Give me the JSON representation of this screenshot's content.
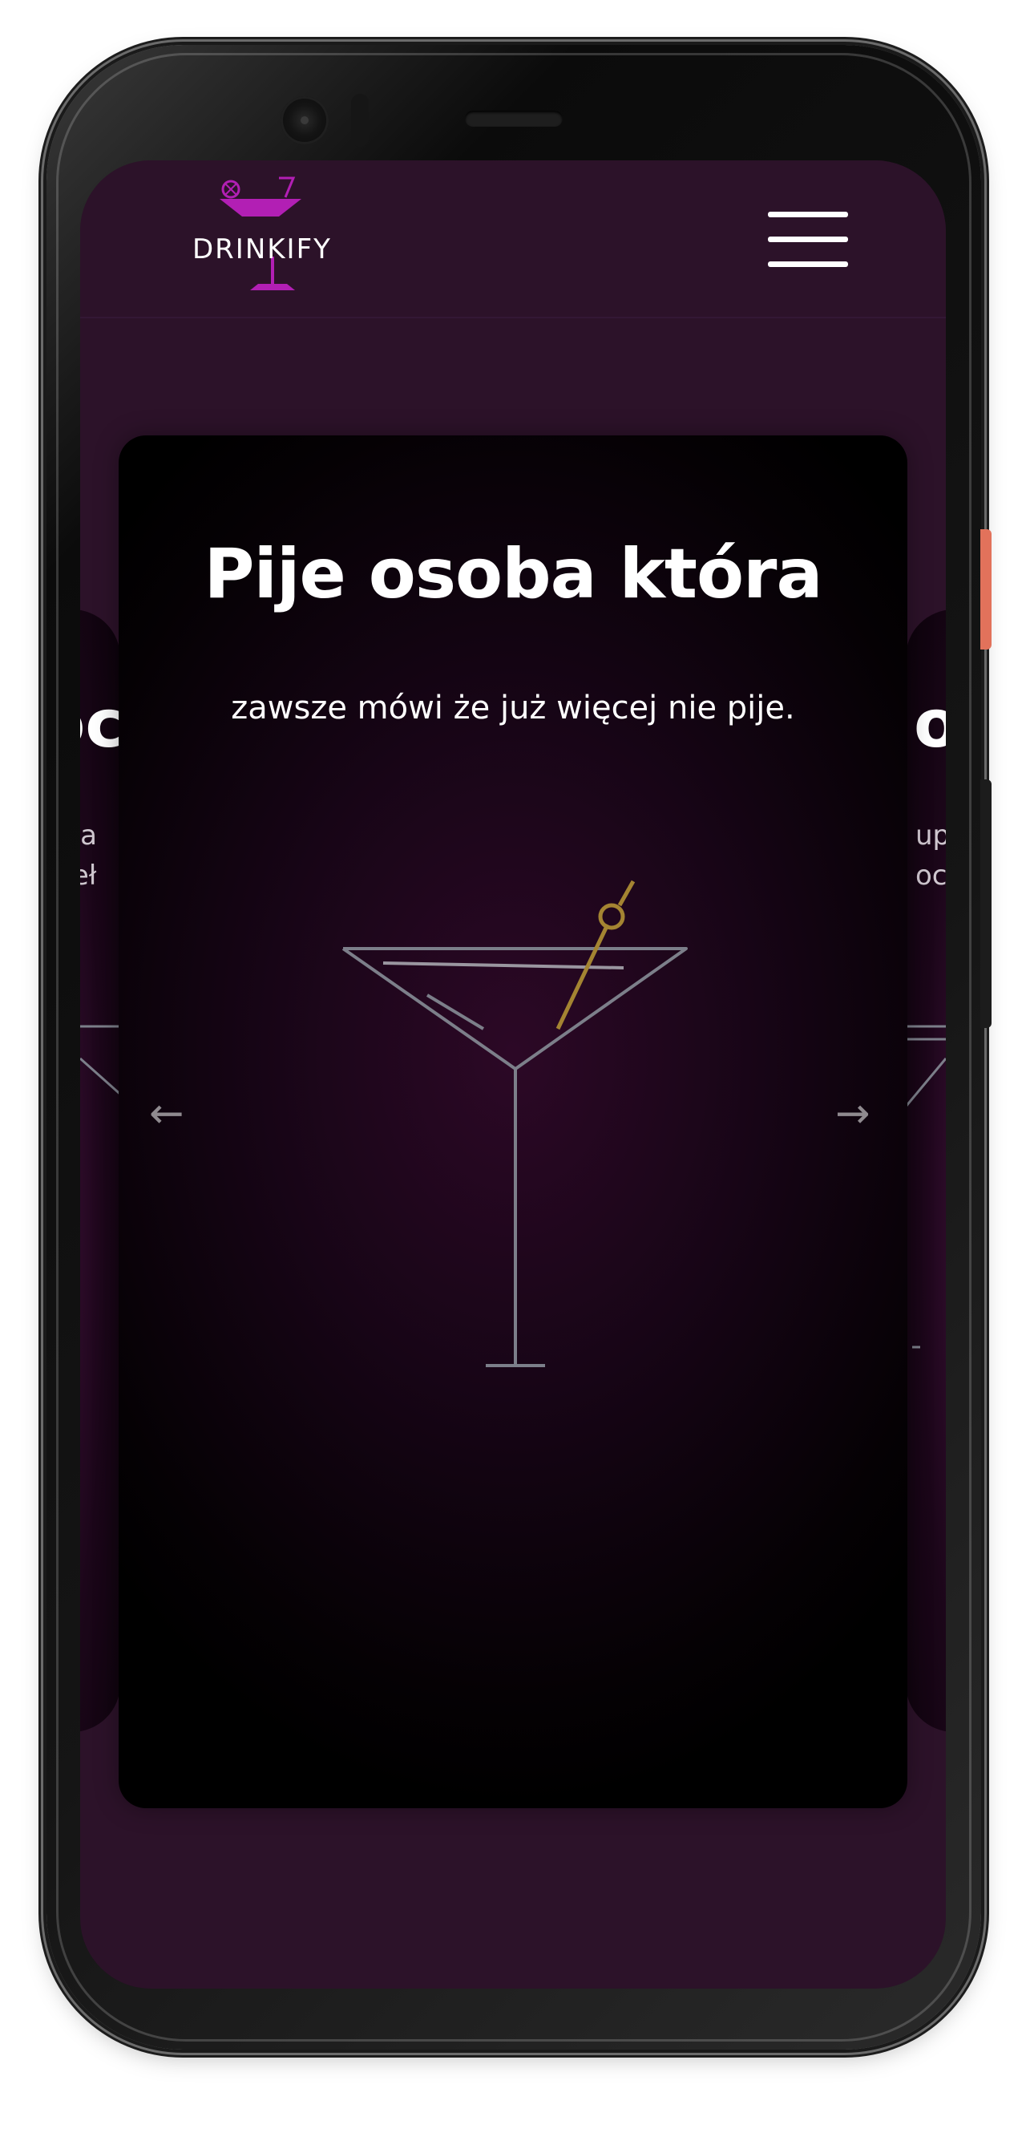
{
  "header": {
    "logo_text": "DRINKIFY",
    "brand_color": "#b21fb4"
  },
  "card": {
    "title": "Pije osoba która",
    "text": "zawsze mówi że już więcej nie pije."
  },
  "peek": {
    "left_title": "oc",
    "left_line1": "cja",
    "left_line2": "zeł",
    "right_title": "ob",
    "right_line1": "upr",
    "right_line2": "och"
  },
  "carousel": {
    "prev_icon": "arrow-left-icon",
    "next_icon": "arrow-right-icon",
    "prev_glyph": "←",
    "next_glyph": "→"
  },
  "colors": {
    "page_bg": "#2c1229",
    "card_bg": "#000000",
    "accent_olive": "#a48432",
    "glass_line": "#7c7f8a"
  }
}
